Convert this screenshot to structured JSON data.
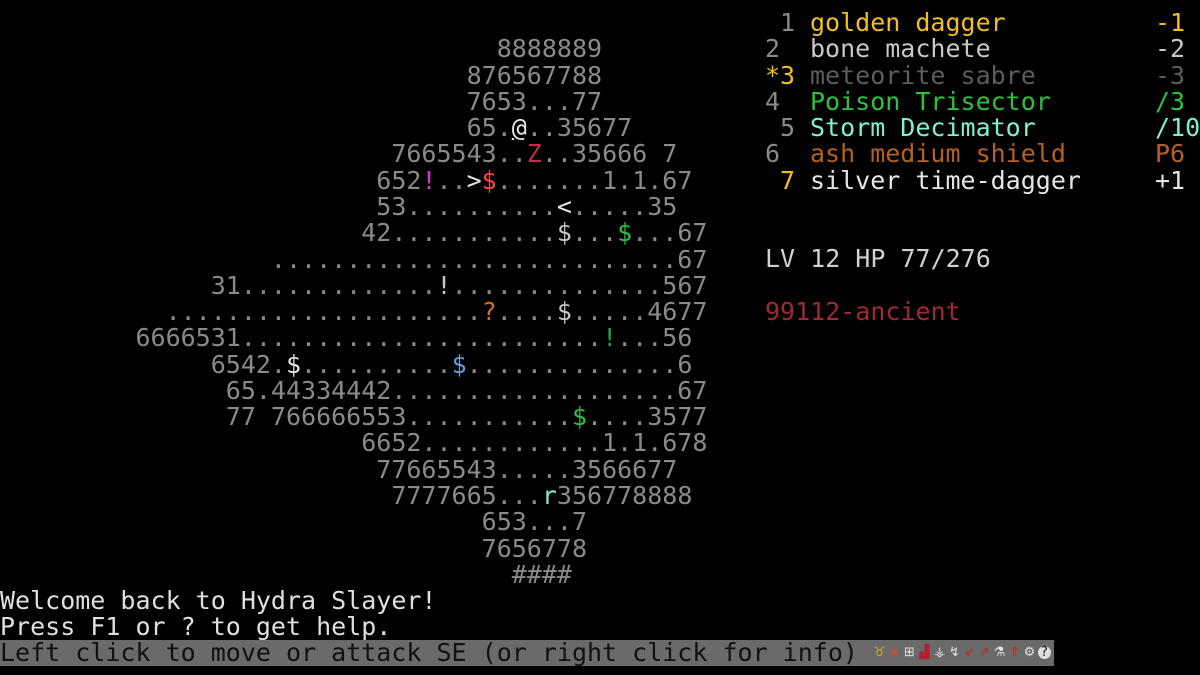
{
  "colors": {
    "gray": "#8a8a8a",
    "white": "#e6e6e6",
    "lightgray": "#c8c8c8",
    "red": "#ff4444",
    "darkred": "#c0304a",
    "magenta": "#d040d0",
    "green": "#30c040",
    "darkgreen": "#20a040",
    "orange": "#d07020",
    "blue": "#6a9ad8",
    "cyan": "#80e8c8",
    "yellow": "#f0c020",
    "dim": "#5c5c5c",
    "teal": "#80f0d0",
    "brown": "#b86020",
    "maroon": "#a02838"
  },
  "map": {
    "rows": [
      [
        [
          "                                 8888889",
          "gray"
        ]
      ],
      [
        [
          "                               876567788",
          "gray"
        ]
      ],
      [
        [
          "                               7653...77",
          "gray"
        ]
      ],
      [
        [
          "                               65.",
          "gray"
        ],
        [
          "@",
          "white",
          "player"
        ],
        [
          "..35677",
          "gray"
        ]
      ],
      [
        [
          "                          7665543..",
          "gray"
        ],
        [
          "Z",
          "darkred",
          "monster"
        ],
        [
          "..35666 7",
          "gray"
        ]
      ],
      [
        [
          "                         652",
          "gray"
        ],
        [
          "!",
          "magenta",
          "potion"
        ],
        [
          "..",
          "gray"
        ],
        [
          ">",
          "white",
          "stairs-down"
        ],
        [
          "$",
          "red",
          "treasure"
        ],
        [
          ".......1.1.67",
          "gray"
        ]
      ],
      [
        [
          "                         53..........",
          "gray"
        ],
        [
          "<",
          "white",
          "stairs-up"
        ],
        [
          ".....35",
          "gray"
        ]
      ],
      [
        [
          "                        42...........",
          "gray"
        ],
        [
          "$",
          "lightgray",
          "treasure"
        ],
        [
          "...",
          "gray"
        ],
        [
          "$",
          "green",
          "treasure"
        ],
        [
          "...67",
          "gray"
        ]
      ],
      [
        [
          "                  ...........................67",
          "gray"
        ]
      ],
      [
        [
          "              31.............",
          "gray"
        ],
        [
          "!",
          "lightgray",
          "potion"
        ],
        [
          "..............567",
          "gray"
        ]
      ],
      [
        [
          "           .....................",
          "gray"
        ],
        [
          "?",
          "orange",
          "scroll"
        ],
        [
          "....",
          "gray"
        ],
        [
          "$",
          "lightgray",
          "treasure"
        ],
        [
          ".....4677",
          "gray"
        ]
      ],
      [
        [
          "         6666531........................",
          "gray"
        ],
        [
          "!",
          "darkgreen",
          "potion"
        ],
        [
          "...56",
          "gray"
        ]
      ],
      [
        [
          "              6542.",
          "gray"
        ],
        [
          "$",
          "white",
          "treasure"
        ],
        [
          "..........",
          "gray"
        ],
        [
          "$",
          "blue",
          "treasure"
        ],
        [
          "..............6",
          "gray"
        ]
      ],
      [
        [
          "               65.44334442...................67",
          "gray"
        ]
      ],
      [
        [
          "               77 766666553...........",
          "gray"
        ],
        [
          "$",
          "green",
          "treasure"
        ],
        [
          "....3577",
          "gray"
        ]
      ],
      [
        [
          "                        6652............1.1.678",
          "gray"
        ]
      ],
      [
        [
          "                         77665543.....3566677",
          "gray"
        ]
      ],
      [
        [
          "                          7777665...",
          "gray"
        ],
        [
          "r",
          "cyan",
          "monster"
        ],
        [
          "356778888",
          "gray"
        ]
      ],
      [
        [
          "                                653...7",
          "gray"
        ]
      ],
      [
        [
          "                                7656778",
          "gray"
        ]
      ],
      [
        [
          "                                  ####",
          "gray"
        ]
      ]
    ]
  },
  "inventory": [
    {
      "num": " 1",
      "num_color": "gray",
      "name": "golden dagger",
      "color": "yellow",
      "value": "-1"
    },
    {
      "num": "2",
      "num_color": "gray",
      "name": "bone machete",
      "color": "lightgray",
      "value": "-2"
    },
    {
      "num": "*3",
      "num_color": "yellow",
      "name": "meteorite sabre",
      "color": "dim",
      "value": "-3"
    },
    {
      "num": "4",
      "num_color": "gray",
      "name": "Poison Trisector",
      "color": "green",
      "value": "/3"
    },
    {
      "num": " 5",
      "num_color": "gray",
      "name": "Storm Decimator",
      "color": "teal",
      "value": "/10"
    },
    {
      "num": "6",
      "num_color": "gray",
      "name": "ash medium shield",
      "color": "brown",
      "value": "P6"
    },
    {
      "num": " 7",
      "num_color": "yellow",
      "name": "silver time-dagger",
      "color": "white",
      "value": "+1"
    }
  ],
  "stats": {
    "text": "LV 12 HP 77/276"
  },
  "seed": {
    "text": "99112-ancient"
  },
  "messages": [
    "Welcome back to Hydra Slayer!",
    "Press F1 or ? to get help."
  ],
  "status_bar": {
    "text": "Left click to move or attack SE (or right click for info)",
    "icons": [
      {
        "name": "amulet-icon",
        "glyph": "♉",
        "color": "#c8b020"
      },
      {
        "name": "rune-icon",
        "glyph": "◈",
        "color": "#c05040"
      },
      {
        "name": "scroll-icon",
        "glyph": "⊞",
        "color": "#e0e0e0"
      },
      {
        "name": "ship-icon",
        "glyph": "▟",
        "color": "#b02030"
      },
      {
        "name": "split-icon",
        "glyph": "⚶",
        "color": "#e0e0e0"
      },
      {
        "name": "arrow-icon",
        "glyph": "↯",
        "color": "#e0e0e0"
      },
      {
        "name": "sword-down-icon",
        "glyph": "⇙",
        "color": "#b03030"
      },
      {
        "name": "sword-up-icon",
        "glyph": "⇗",
        "color": "#b03030"
      },
      {
        "name": "potion-icon",
        "glyph": "⚗",
        "color": "#e0e0e0"
      },
      {
        "name": "thermometer-icon",
        "glyph": "⇑",
        "color": "#d02020"
      },
      {
        "name": "gear-icon",
        "glyph": "⚙",
        "color": "#e0e0e0"
      },
      {
        "name": "help-icon",
        "glyph": "?",
        "color": "#111"
      }
    ]
  }
}
